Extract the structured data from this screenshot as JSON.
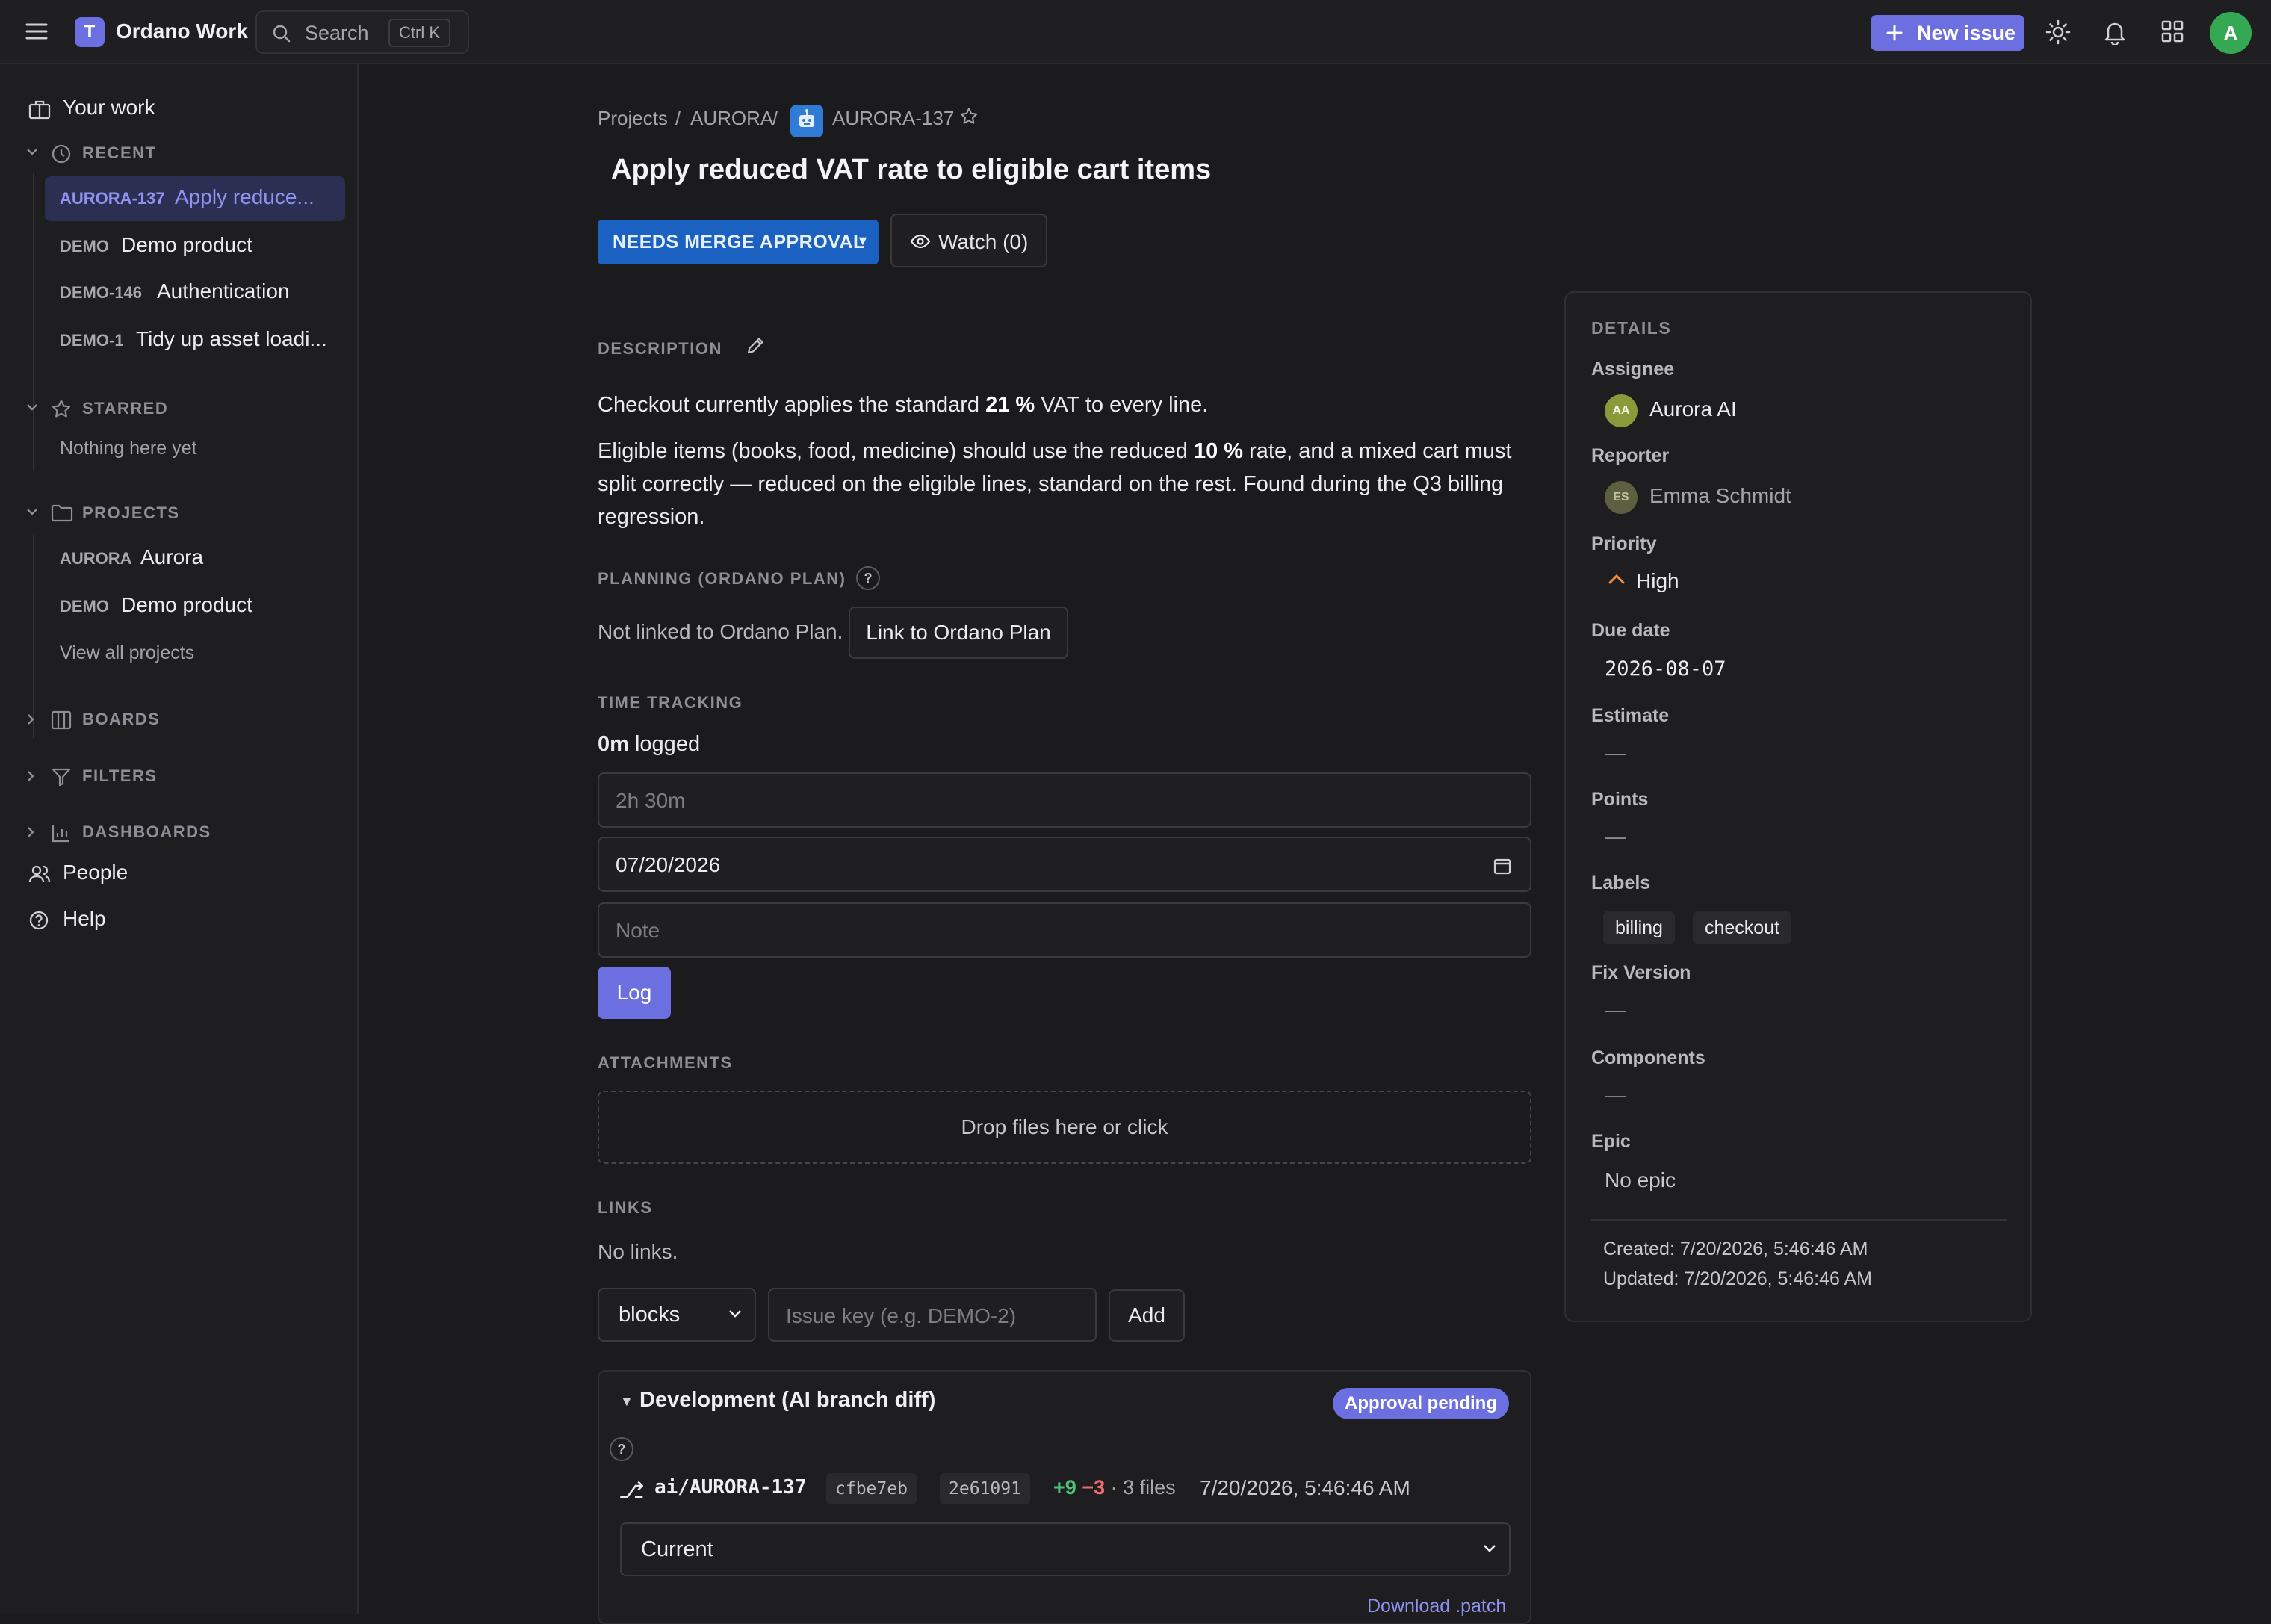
{
  "app": {
    "logo_letter": "T",
    "name": "Ordano Work"
  },
  "search": {
    "label": "Search",
    "shortcut": "Ctrl K"
  },
  "header": {
    "new_issue": "New issue",
    "avatar": "A"
  },
  "sidebar": {
    "your_work": "Your work",
    "recent": {
      "title": "RECENT",
      "items": [
        {
          "key": "AURORA-137",
          "name": "Apply reduce..."
        },
        {
          "key": "DEMO",
          "name": "Demo product"
        },
        {
          "key": "DEMO-146",
          "name": "Authentication"
        },
        {
          "key": "DEMO-1",
          "name": "Tidy up asset loadi..."
        }
      ]
    },
    "starred": {
      "title": "STARRED",
      "empty": "Nothing here yet"
    },
    "projects": {
      "title": "PROJECTS",
      "items": [
        {
          "key": "AURORA",
          "name": "Aurora"
        },
        {
          "key": "DEMO",
          "name": "Demo product"
        }
      ],
      "view_all": "View all projects"
    },
    "boards": "BOARDS",
    "filters": "FILTERS",
    "dashboards": "DASHBOARDS",
    "people": "People",
    "help": "Help"
  },
  "breadcrumb": {
    "projects": "Projects",
    "sep": "/",
    "project": "AURORA",
    "issue": "AURORA-137"
  },
  "issue": {
    "title": "Apply reduced VAT rate to eligible cart items",
    "status": "NEEDS MERGE APPROVAL",
    "watch": "Watch (0)"
  },
  "description": {
    "heading": "DESCRIPTION",
    "p1_a": "Checkout currently applies the standard ",
    "p1_b": "21 %",
    "p1_c": " VAT to every line.",
    "p2_a": "Eligible items (books, food, medicine) should use the reduced ",
    "p2_b": "10 %",
    "p2_c": " rate, and a mixed cart must split correctly — reduced on the eligible lines, standard on the rest. Found during the Q3 billing regression."
  },
  "planning": {
    "heading": "PLANNING (ORDANO PLAN)",
    "status": "Not linked to Ordano Plan.",
    "link_button": "Link to Ordano Plan"
  },
  "time_tracking": {
    "heading": "TIME TRACKING",
    "logged_value": "0m",
    "logged_suffix": "logged",
    "duration_placeholder": "2h 30m",
    "date_value": "07/20/2026",
    "note_placeholder": "Note",
    "log_button": "Log"
  },
  "attachments": {
    "heading": "ATTACHMENTS",
    "drop": "Drop files here or click"
  },
  "links": {
    "heading": "LINKS",
    "empty": "No links.",
    "type_selected": "blocks",
    "key_placeholder": "Issue key (e.g. DEMO-2)",
    "add_button": "Add"
  },
  "development": {
    "title": "Development (AI branch diff)",
    "badge": "Approval pending",
    "help": "?",
    "branch_icon": "⎇",
    "branch": "ai/AURORA-137",
    "sha1": "cfbe7eb",
    "sha2": "2e61091",
    "additions": "+9",
    "deletions": "−3",
    "files": "· 3 files",
    "timestamp": "7/20/2026, 5:46:46 AM",
    "version_selected": "Current",
    "download": "Download .patch"
  },
  "details": {
    "heading": "DETAILS",
    "assignee_label": "Assignee",
    "assignee_initials": "AA",
    "assignee": "Aurora AI",
    "reporter_label": "Reporter",
    "reporter_initials": "ES",
    "reporter": "Emma Schmidt",
    "priority_label": "Priority",
    "priority": "High",
    "due_label": "Due date",
    "due": "2026-08-07",
    "estimate_label": "Estimate",
    "estimate": "—",
    "points_label": "Points",
    "points": "—",
    "labels_label": "Labels",
    "labels": [
      "billing",
      "checkout"
    ],
    "fix_version_label": "Fix Version",
    "fix_version": "—",
    "components_label": "Components",
    "components": "—",
    "epic_label": "Epic",
    "epic": "No epic",
    "created": "Created: 7/20/2026, 5:46:46 AM",
    "updated": "Updated: 7/20/2026, 5:46:46 AM"
  },
  "colors": {
    "accent": "#6c6fe0",
    "status_blue": "#1b61c1",
    "priority_high": "#f08a3c",
    "avatar_green": "#34a853"
  }
}
